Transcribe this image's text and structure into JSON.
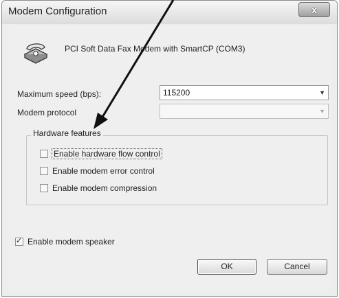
{
  "dialog": {
    "title": "Modem Configuration",
    "close_symbol": "x",
    "modem_name": "PCI Soft Data Fax Modem with SmartCP (COM3)"
  },
  "fields": {
    "max_speed_label": "Maximum speed (bps):",
    "max_speed_value": "115200",
    "protocol_label": "Modem protocol",
    "protocol_value": ""
  },
  "hardware": {
    "title": "Hardware features",
    "items": [
      {
        "label": "Enable hardware flow control",
        "checked": false
      },
      {
        "label": "Enable modem error control",
        "checked": false
      },
      {
        "label": "Enable modem compression",
        "checked": false
      }
    ]
  },
  "speaker": {
    "label": "Enable modem speaker",
    "checked": true
  },
  "buttons": {
    "ok": "OK",
    "cancel": "Cancel"
  },
  "icons": {
    "close": "close-icon",
    "modem": "modem-phone-icon",
    "dropdown": "chevron-down-icon"
  }
}
